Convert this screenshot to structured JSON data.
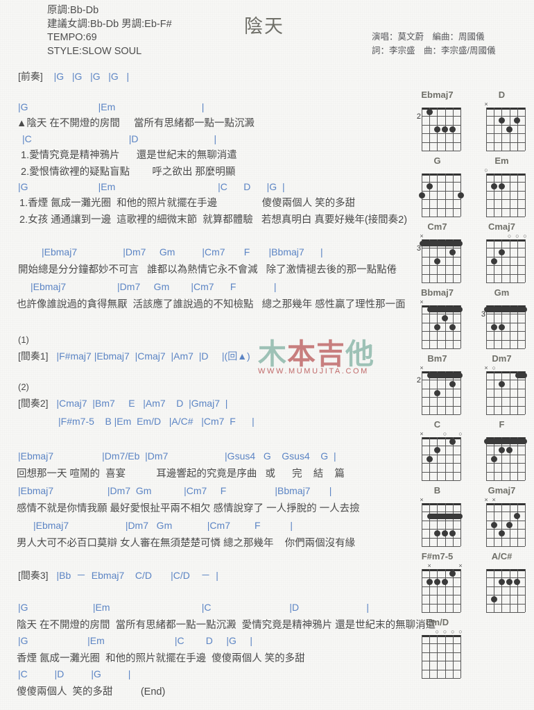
{
  "header": {
    "meta": [
      "原調:Bb-Db",
      "建議女調:Bb-Db 男調:Eb-F#",
      "TEMPO:69",
      "STYLE:SLOW SOUL"
    ],
    "title": "陰天",
    "credits": [
      "演唱：莫文蔚　編曲：周國儀",
      "詞：李宗盛　曲：李宗盛/周國儀"
    ]
  },
  "watermark": {
    "text": "木本吉他",
    "sub": "WWW.MUMUJITA.COM",
    "color1": "#8fb9ac",
    "color2": "#c06a6a"
  },
  "sheet": {
    "intro_label": "[前奏]",
    "intro_chords": "|G   |G   |G   |G   |",
    "l1_chords": "|G                          |Em                                |",
    "l1_lyric": "▲陰天 在不開燈的房間     當所有思緒都一點一點沉澱",
    "l2_chords": "|C                                    |D                            |",
    "l2_lyric1": "1.愛情究竟是精神鴉片      還是世紀末的無聊消遣",
    "l2_lyric2": "2.愛恨情欲裡的疑點盲點        呼之欲出 那麼明顯",
    "l3_chords": "|G                          |Em                                      |C      D      |G  |",
    "l3_lyric1": "1.香煙 氤成一灘光圈  和他的照片就擺在手邊                傻傻兩個人 笑的多甜",
    "l3_lyric2": "2.女孩 通通讓到一邊  這歌裡的細微末節  就算都體驗   若想真明白 真要好幾年(接間奏2)",
    "l4_chords": "|Ebmaj7                 |Dm7     Gm          |Cm7       F       |Bbmaj7      |",
    "l4_lyric": "開始總是分分鐘都妙不可言   誰都以為熱情它永不會減   除了激情褪去後的那一點點倦",
    "l5_chords": "|Ebmaj7                   |Dm7     Gm        |Cm7      F              |",
    "l5_lyric": "也許像誰說過的貪得無厭  活該應了誰說過的不知檢點   總之那幾年 感性贏了理性那一面",
    "mark1": "(1)",
    "interlude1_label": "[間奏1]",
    "interlude1_chords": "|F#maj7 |Ebmaj7  |Cmaj7  |Am7  |D     |(回▲)",
    "mark2": "(2)",
    "interlude2_label": "[間奏2]",
    "interlude2_chords": "|Cmaj7  |Bm7     E   |Am7    D  |Gmaj7  |",
    "interlude2_chords2": "|F#m7-5    B |Em  Em/D   |A/C#   |Cm7  F      |",
    "l6_chords": "|Ebmaj7                  |Dm7/Eb  |Dm7                     |Gsus4   G    Gsus4    G  |",
    "l6_lyric": "回想那一天 喧鬧的  喜宴           耳邊響起的究竟是序曲   或      完    結    篇",
    "l7_chords": "|Ebmaj7                    |Dm7  Gm            |Cm7     F                  |Bbmaj7       |",
    "l7_lyric": "感情不就是你情我願 最好愛恨扯平兩不相欠 感情說穿了 一人掙脫的 一人去撿",
    "l8_chords": "|Ebmaj7                     |Dm7   Gm             |Cm7         F           |",
    "l8_lyric": "男人大可不必百口莫辯 女人審在無須楚楚可憐 總之那幾年    你們兩個沒有緣",
    "interlude3_label": "[間奏3]",
    "interlude3_chords": "|Bb  －  Ebmaj7    C/D       |C/D    －  |",
    "l9_chords": "|G                        |Em                                  |C                             |D                         |",
    "l9_lyric": "陰天 在不開燈的房間  當所有思緒都一點一點沉澱  愛情究竟是精神鴉片 還是世紀末的無聊消遣",
    "l10_chords": "|G                      |Em                          |C        D     |G     |",
    "l10_lyric": "香煙 氤成一灘光圈  和他的照片就擺在手邊  傻傻兩個人 笑的多甜",
    "l11_chords": "|C          |D          |G          |",
    "l11_lyric": "傻傻兩個人  笑的多甜          (End)"
  },
  "diagrams": [
    {
      "name": "Ebmaj7",
      "fret": "2",
      "marks": [],
      "barre": null,
      "dots": [
        {
          "s": 1,
          "f": 1
        },
        {
          "s": 2,
          "f": 3
        },
        {
          "s": 3,
          "f": 3
        },
        {
          "s": 4,
          "f": 3
        }
      ],
      "strings": 5,
      "offset": 1
    },
    {
      "name": "D",
      "fret": "",
      "marks": [
        {
          "s": 0,
          "t": "x"
        }
      ],
      "barre": null,
      "dots": [
        {
          "s": 2,
          "f": 2
        },
        {
          "s": 3,
          "f": 3
        },
        {
          "s": 4,
          "f": 2
        }
      ],
      "strings": 5,
      "offset": 0
    },
    {
      "name": "G",
      "fret": "",
      "marks": [],
      "barre": null,
      "dots": [
        {
          "s": 0,
          "f": 3
        },
        {
          "s": 1,
          "f": 2
        },
        {
          "s": 5,
          "f": 3
        }
      ],
      "strings": 6,
      "offset": 0
    },
    {
      "name": "Em",
      "fret": "",
      "marks": [
        {
          "s": 0,
          "t": "o"
        }
      ],
      "barre": null,
      "dots": [
        {
          "s": 1,
          "f": 2
        },
        {
          "s": 2,
          "f": 2
        }
      ],
      "strings": 6,
      "offset": 0
    },
    {
      "name": "Cm7",
      "fret": "3",
      "marks": [
        {
          "s": 0,
          "t": "x"
        }
      ],
      "barre": {
        "f": 1,
        "from": 0,
        "to": 5
      },
      "dots": [
        {
          "s": 2,
          "f": 3
        },
        {
          "s": 4,
          "f": 2
        }
      ],
      "strings": 6,
      "offset": 0
    },
    {
      "name": "Cmaj7",
      "fret": "",
      "marks": [
        {
          "s": 3,
          "t": "o"
        },
        {
          "s": 4,
          "t": "o"
        },
        {
          "s": 5,
          "t": "o"
        }
      ],
      "barre": null,
      "dots": [
        {
          "s": 1,
          "f": 3
        },
        {
          "s": 2,
          "f": 2
        }
      ],
      "strings": 6,
      "offset": 0
    },
    {
      "name": "Bbmaj7",
      "fret": "",
      "marks": [
        {
          "s": 0,
          "t": "x"
        }
      ],
      "barre": {
        "f": 1,
        "from": 1,
        "to": 5
      },
      "dots": [
        {
          "s": 2,
          "f": 3
        },
        {
          "s": 3,
          "f": 2
        },
        {
          "s": 4,
          "f": 3
        }
      ],
      "strings": 6,
      "offset": 0
    },
    {
      "name": "Gm",
      "fret": "3",
      "marks": [],
      "barre": {
        "f": 1,
        "from": 0,
        "to": 5
      },
      "dots": [
        {
          "s": 1,
          "f": 3
        },
        {
          "s": 2,
          "f": 3
        }
      ],
      "strings": 6,
      "offset": 0
    },
    {
      "name": "Bm7",
      "fret": "2",
      "marks": [
        {
          "s": 0,
          "t": "x"
        }
      ],
      "barre": {
        "f": 1,
        "from": 1,
        "to": 5
      },
      "dots": [
        {
          "s": 2,
          "f": 3
        },
        {
          "s": 4,
          "f": 2
        }
      ],
      "strings": 6,
      "offset": 0
    },
    {
      "name": "Dm7",
      "fret": "",
      "marks": [
        {
          "s": 0,
          "t": "x"
        },
        {
          "s": 1,
          "t": "o"
        }
      ],
      "barre": {
        "f": 1,
        "from": 4,
        "to": 5
      },
      "dots": [
        {
          "s": 2,
          "f": 2
        }
      ],
      "strings": 6,
      "offset": 0
    },
    {
      "name": "C",
      "fret": "",
      "marks": [
        {
          "s": 0,
          "t": "x"
        },
        {
          "s": 3,
          "t": "o"
        },
        {
          "s": 5,
          "t": "o"
        }
      ],
      "barre": null,
      "dots": [
        {
          "s": 1,
          "f": 3
        },
        {
          "s": 2,
          "f": 2
        },
        {
          "s": 4,
          "f": 1
        }
      ],
      "strings": 6,
      "offset": 0
    },
    {
      "name": "F",
      "fret": "",
      "marks": [],
      "barre": {
        "f": 1,
        "from": 0,
        "to": 5
      },
      "dots": [
        {
          "s": 1,
          "f": 3
        },
        {
          "s": 2,
          "f": 2
        },
        {
          "s": 3,
          "f": 2
        }
      ],
      "strings": 6,
      "offset": 0
    },
    {
      "name": "B",
      "fret": "",
      "marks": [
        {
          "s": 0,
          "t": "x"
        }
      ],
      "barre": {
        "f": 2,
        "from": 1,
        "to": 5
      },
      "dots": [
        {
          "s": 2,
          "f": 4
        },
        {
          "s": 3,
          "f": 4
        },
        {
          "s": 4,
          "f": 4
        }
      ],
      "strings": 6,
      "offset": 0
    },
    {
      "name": "Gmaj7",
      "fret": "",
      "marks": [
        {
          "s": 0,
          "t": "x"
        },
        {
          "s": 1,
          "t": "x"
        }
      ],
      "barre": null,
      "dots": [
        {
          "s": 4,
          "f": 2
        },
        {
          "s": 3,
          "f": 3
        },
        {
          "s": 2,
          "f": 4
        },
        {
          "s": 1,
          "f": 3
        }
      ],
      "strings": 6,
      "offset": 0
    },
    {
      "name": "F#m7-5",
      "fret": "",
      "marks": [
        {
          "s": 1,
          "t": "x"
        },
        {
          "s": 5,
          "t": "x"
        }
      ],
      "barre": null,
      "dots": [
        {
          "s": 1,
          "f": 2
        },
        {
          "s": 2,
          "f": 2
        },
        {
          "s": 3,
          "f": 2
        },
        {
          "s": 4,
          "f": 1
        }
      ],
      "strings": 6,
      "offset": 0
    },
    {
      "name": "A/C#",
      "fret": "",
      "marks": [],
      "barre": null,
      "dots": [
        {
          "s": 2,
          "f": 2
        },
        {
          "s": 3,
          "f": 2
        },
        {
          "s": 4,
          "f": 2
        },
        {
          "s": 1,
          "f": 4
        }
      ],
      "strings": 6,
      "offset": 0
    },
    {
      "name": "Em/D",
      "fret": "",
      "marks": [
        {
          "s": 2,
          "t": "o"
        },
        {
          "s": 3,
          "t": "o"
        },
        {
          "s": 4,
          "t": "o"
        },
        {
          "s": 5,
          "t": "o"
        }
      ],
      "barre": null,
      "dots": [],
      "strings": 6,
      "offset": 0
    }
  ]
}
